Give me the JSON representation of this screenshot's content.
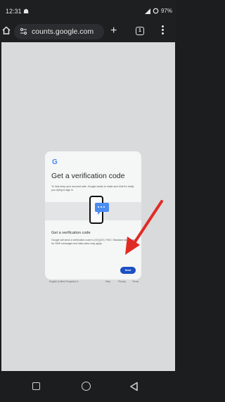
{
  "status_bar": {
    "time": "12:31",
    "left_icon": "☗",
    "battery": "97%",
    "icons": [
      "signal-icon",
      "wifi-icon",
      "alarm-icon",
      "battery-icon"
    ]
  },
  "toolbar": {
    "url": "counts.google.com",
    "tab_count": "1",
    "icons": [
      "home-icon",
      "site-settings-icon",
      "new-tab-icon",
      "tabs-icon",
      "more-menu-icon"
    ]
  },
  "page": {
    "logo": "G",
    "title": "Get a verification code",
    "description": "To help keep your account safe, Google wants to make sure that it's really you trying to sign in",
    "subheading": "Get a verification code",
    "note": "Google will send a verification code to (XX)(XX) 79XX. Standard rates apply for SMS messages and data rates may apply.",
    "send_button": "Send",
    "footer": {
      "language": "English (United Kingdom) ▾",
      "help": "Help",
      "privacy": "Privacy",
      "terms": "Terms"
    }
  },
  "colors": {
    "accent": "#1a4fc4",
    "annotation_arrow": "#e02b25",
    "google_blue": "#4285f4"
  }
}
